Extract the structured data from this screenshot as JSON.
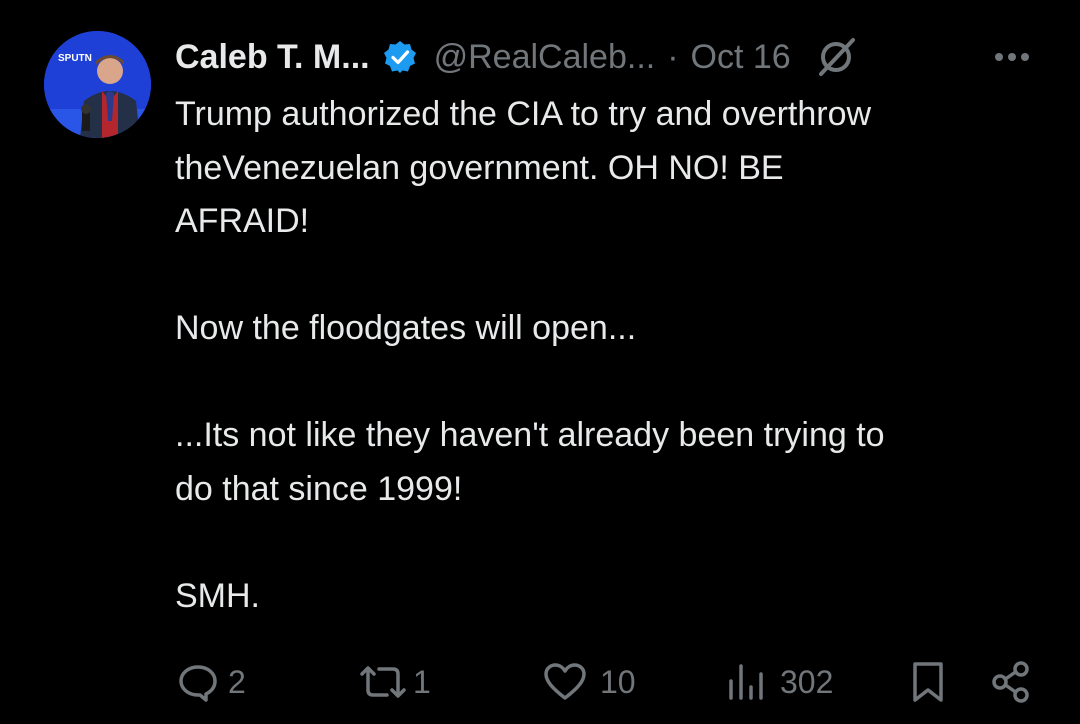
{
  "post": {
    "author_name": "Caleb T. M...",
    "handle": "@RealCaleb...",
    "separator": "·",
    "date": "Oct 16",
    "text": "Trump authorized the CIA to try and overthrow\ntheVenezuelan government. OH NO! BE\nAFRAID!\n\nNow the floodgates will open...\n\n...Its not like they haven't already been trying to\ndo that since 1999!\n\nSMH."
  },
  "avatar": {
    "logo_text": "SPUTN"
  },
  "actions": {
    "replies": "2",
    "reposts": "1",
    "likes": "10",
    "views": "302"
  },
  "colors": {
    "background": "#000000",
    "text": "#e7e9ea",
    "muted": "#71767b",
    "verified": "#1d9bf0"
  },
  "icons": [
    "verified-badge-icon",
    "grok-icon",
    "more-icon",
    "reply-icon",
    "repost-icon",
    "like-icon",
    "views-icon",
    "bookmark-icon",
    "share-icon"
  ]
}
